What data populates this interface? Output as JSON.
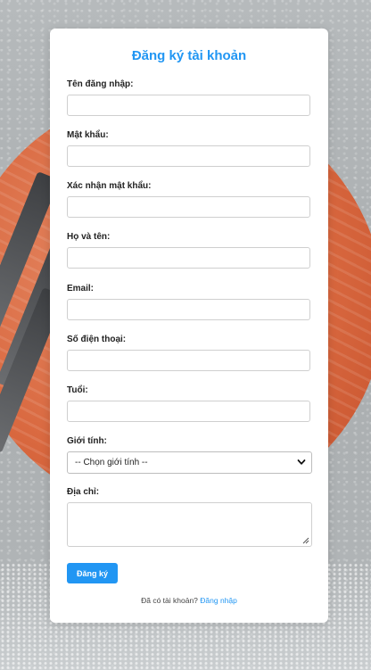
{
  "form": {
    "title": "Đăng ký tài khoản",
    "fields": {
      "username_label": "Tên đăng nhập:",
      "username_value": "",
      "password_label": "Mật khẩu:",
      "password_value": "",
      "confirm_label": "Xác nhận mật khẩu:",
      "confirm_value": "",
      "fullname_label": "Họ và tên:",
      "fullname_value": "",
      "email_label": "Email:",
      "email_value": "",
      "phone_label": "Số điện thoại:",
      "phone_value": "",
      "age_label": "Tuổi:",
      "age_value": "",
      "gender_label": "Giới tính:",
      "gender_selected": "-- Chọn giới tính --",
      "address_label": "Địa chỉ:",
      "address_value": ""
    },
    "submit_label": "Đăng ký",
    "footer": {
      "text": "Đã có tài khoản?",
      "link": "Đăng nhập"
    }
  },
  "colors": {
    "accent": "#2196f3",
    "background_shoe": "#d9683f"
  }
}
